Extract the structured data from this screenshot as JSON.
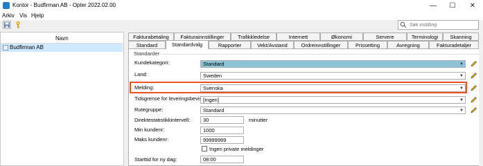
{
  "window": {
    "title": "Kontor - Budfirman AB - Opter 2022.02.00",
    "controls": [
      "minimize-icon",
      "maximize-icon",
      "close-icon"
    ]
  },
  "menu": {
    "items": [
      "Arkiv",
      "Vis",
      "Hjelp"
    ]
  },
  "toolbar": {
    "buttons": [
      "save-icon",
      "key-icon"
    ],
    "search_placeholder": "Søk instilling"
  },
  "tree": {
    "header": "Navn",
    "items": [
      {
        "label": "Budfirman AB",
        "selected": true
      }
    ]
  },
  "tabs": {
    "row1": [
      "Fakturabetaling",
      "Fakturainnstillinger",
      "Trafikkledelse",
      "Internett",
      "Økonomi",
      "Servere",
      "Terminologi",
      "Skanning"
    ],
    "row2": [
      "Standard",
      "Standardvalg",
      "Rapporter",
      "Vekt/Avstand",
      "Ordreinnstillinger",
      "Prissetting",
      "Avregning",
      "Fakturadetaljer"
    ],
    "active": "Standardvalg"
  },
  "form": {
    "group_title": "Standarder",
    "kundekategori": {
      "label": "Kundekategori:",
      "value": "Standard"
    },
    "land": {
      "label": "Land:",
      "value": "Sweden"
    },
    "melding": {
      "label": "Melding:",
      "value": "Svenska"
    },
    "tidsgrense": {
      "label": "Tidsgrense for leveringsbevis",
      "value": "[Ingen]"
    },
    "rutegruppe": {
      "label": "Rutegruppe:",
      "value": "Standard"
    },
    "direktestatistikk": {
      "label": "Direktestatistikkintervell:",
      "value": "30",
      "unit": "minutter"
    },
    "min_kundenr": {
      "label": "Min kundenr:",
      "value": "1000"
    },
    "maks_kundenr": {
      "label": "Maks kundenr:",
      "value": "99999999"
    },
    "ingen_private": {
      "label": "Ingen private meldinger",
      "checked": false
    },
    "starttid": {
      "label": "Starttid for ny dag:",
      "value": "08:00"
    }
  },
  "colors": {
    "highlight": "#e8531d",
    "selected_combo": "#8dc3d6",
    "tree_selected": "#cde8ff"
  }
}
